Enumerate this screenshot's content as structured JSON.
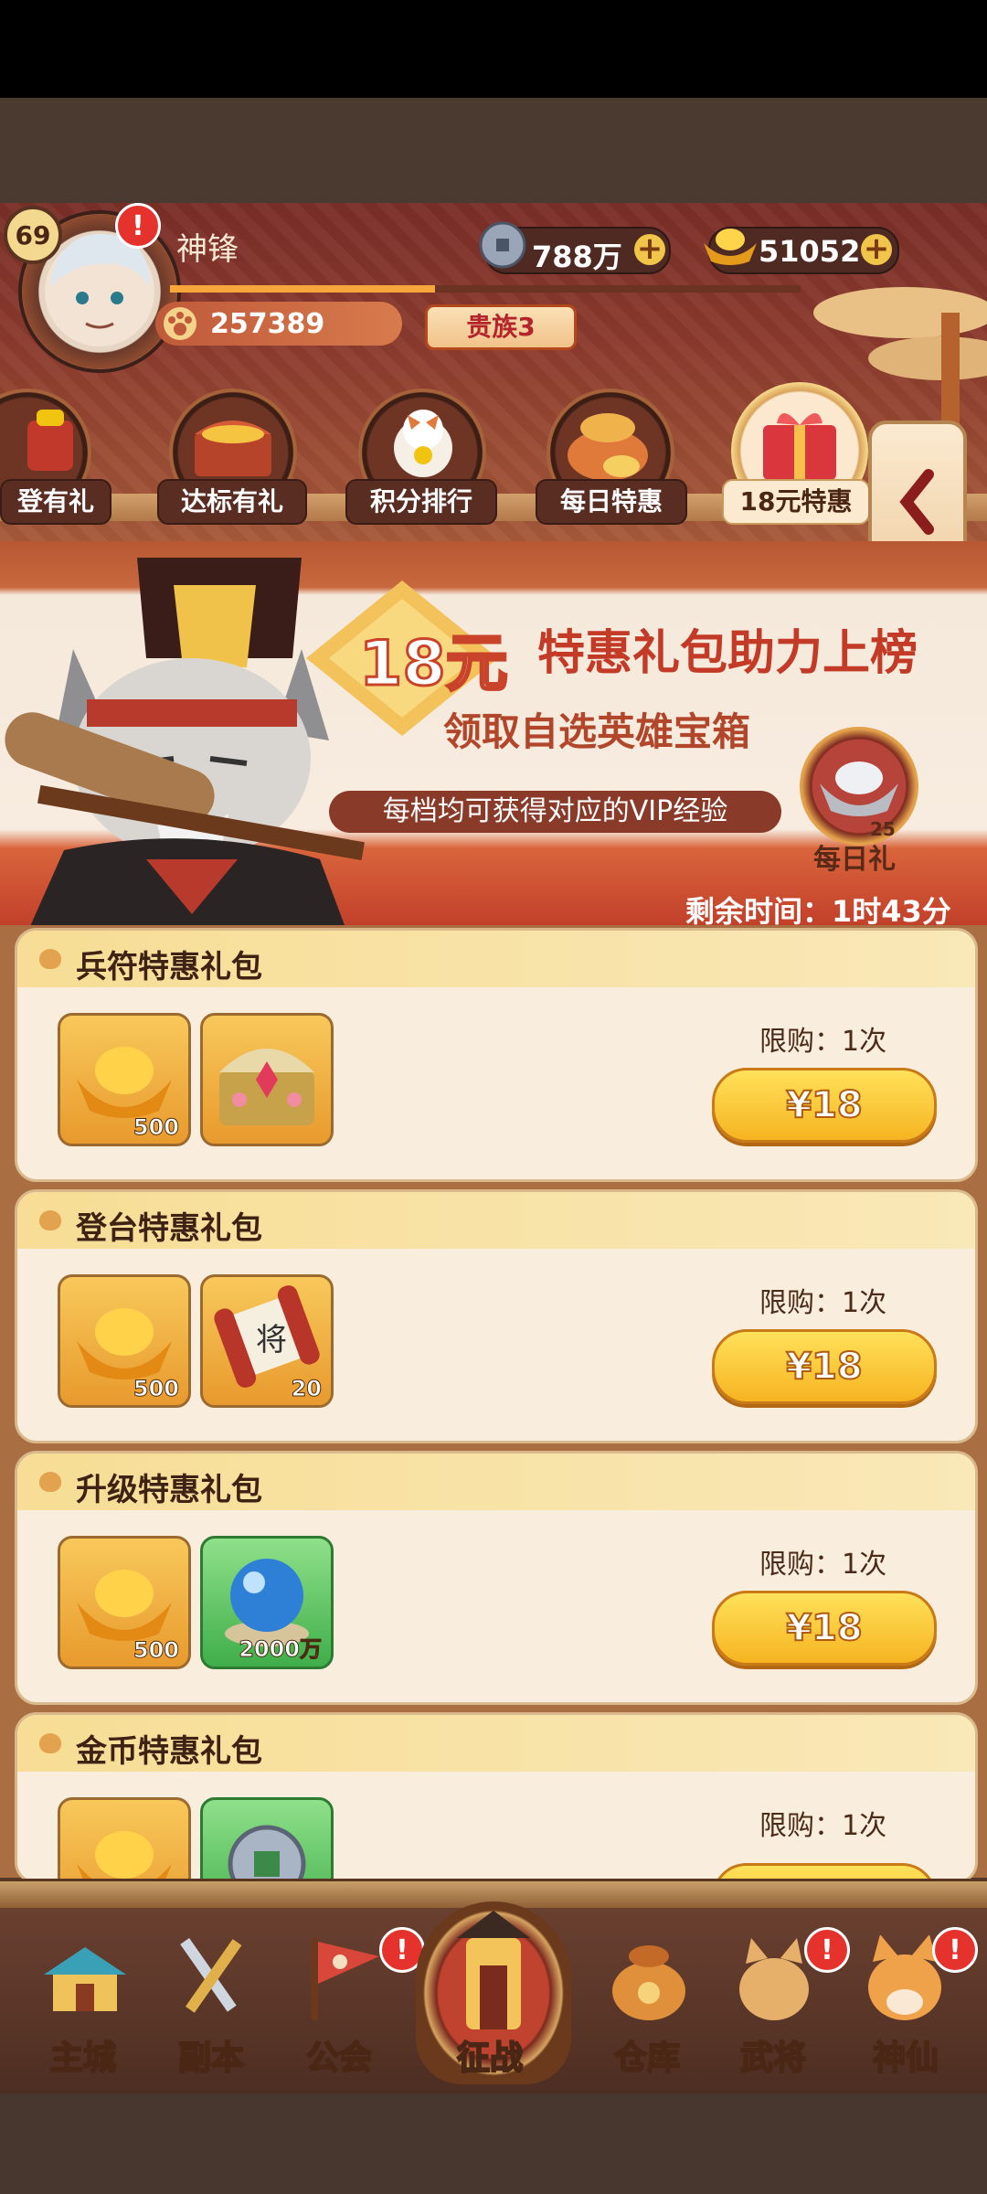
{
  "header": {
    "level": "69",
    "player_name": "神锋",
    "copper": "788万",
    "gold": "51052",
    "power": "257389",
    "vip": "贵族3"
  },
  "events": [
    {
      "label": "登有礼"
    },
    {
      "label": "达标有礼"
    },
    {
      "label": "积分排行"
    },
    {
      "label": "每日特惠"
    },
    {
      "label": "18元特惠"
    }
  ],
  "banner": {
    "price": "18元",
    "title": "特惠礼包助力上榜",
    "subtitle": "领取自选英雄宝箱",
    "vip_note": "每档均可获得对应的VIP经验",
    "daily_label": "每日礼",
    "daily_count": "25",
    "remaining": "剩余时间：1时43分"
  },
  "packs": [
    {
      "title": "兵符特惠礼包",
      "items": [
        {
          "type": "gold",
          "count": "500"
        },
        {
          "type": "chest",
          "count": ""
        }
      ],
      "limit": "限购：1次",
      "price": "¥18"
    },
    {
      "title": "登台特惠礼包",
      "items": [
        {
          "type": "gold",
          "count": "500"
        },
        {
          "type": "scroll",
          "count": "20"
        }
      ],
      "limit": "限购：1次",
      "price": "¥18"
    },
    {
      "title": "升级特惠礼包",
      "items": [
        {
          "type": "gold",
          "count": "500"
        },
        {
          "type": "orb",
          "count": "2000万"
        }
      ],
      "limit": "限购：1次",
      "price": "¥18"
    },
    {
      "title": "金币特惠礼包",
      "items": [
        {
          "type": "gold",
          "count": ""
        },
        {
          "type": "coin",
          "count": ""
        }
      ],
      "limit": "限购：1次",
      "price": ""
    }
  ],
  "nav": [
    {
      "label": "主城"
    },
    {
      "label": "副本"
    },
    {
      "label": "公会"
    },
    {
      "label": "征战"
    },
    {
      "label": "仓库"
    },
    {
      "label": "武将"
    },
    {
      "label": "神仙"
    }
  ],
  "colors": {
    "accent": "#f6b421",
    "banner_red": "#c33a27",
    "alert": "#e5322d"
  }
}
